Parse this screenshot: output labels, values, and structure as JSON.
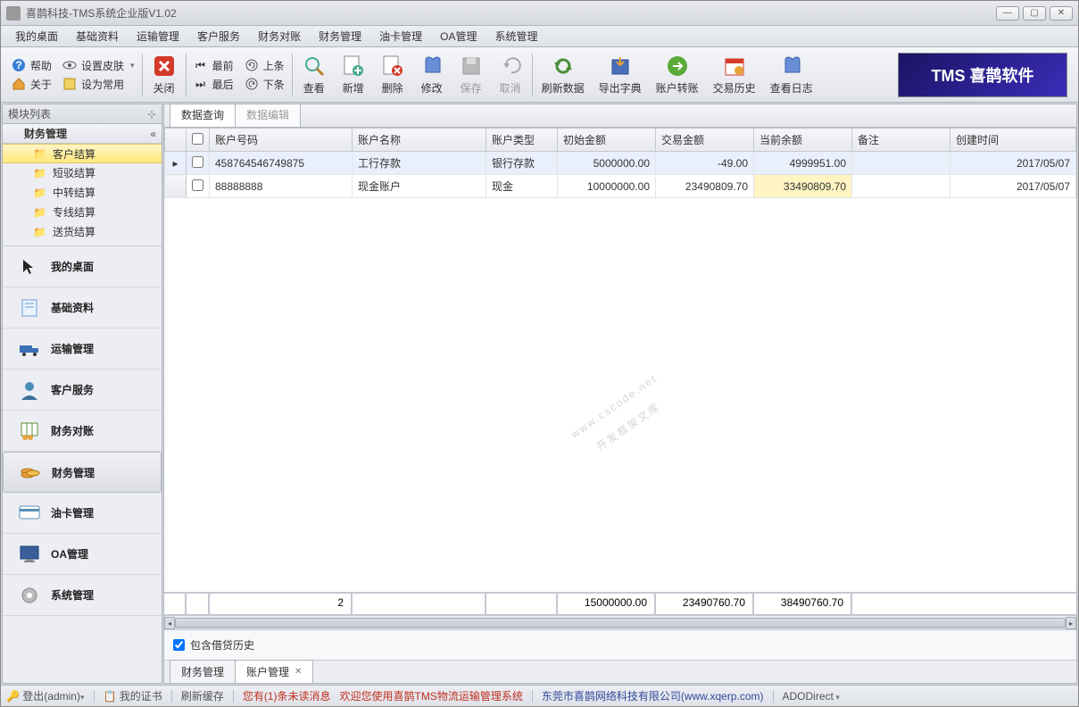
{
  "window": {
    "title": "喜鹊科技-TMS系统企业版V1.02"
  },
  "menubar": [
    "我的桌面",
    "基础资料",
    "运输管理",
    "客户服务",
    "财务对账",
    "财务管理",
    "油卡管理",
    "OA管理",
    "系统管理"
  ],
  "toolbar_left": {
    "help": "帮助",
    "skin": "设置皮肤",
    "about": "关于",
    "fav": "设为常用"
  },
  "toolbar_close": "关闭",
  "toolbar_nav": {
    "first": "最前",
    "last": "最后",
    "prev": "上条",
    "next": "下条"
  },
  "toolbar_big": [
    "查看",
    "新增",
    "删除",
    "修改",
    "保存",
    "取消",
    "刷新数据",
    "导出字典",
    "账户转账",
    "交易历史",
    "查看日志"
  ],
  "brand": "TMS 喜鹊软件",
  "sidebar": {
    "header": "模块列表",
    "tree_header": "财务管理",
    "tree_items": [
      "客户结算",
      "短驳结算",
      "中转结算",
      "专线结算",
      "送货结算"
    ],
    "nav": [
      "我的桌面",
      "基础资料",
      "运输管理",
      "客户服务",
      "财务对账",
      "财务管理",
      "油卡管理",
      "OA管理",
      "系统管理"
    ]
  },
  "inner_tabs": [
    "数据查询",
    "数据编辑"
  ],
  "table": {
    "headers": [
      "账户号码",
      "账户名称",
      "账户类型",
      "初始金额",
      "交易金额",
      "当前余额",
      "备注",
      "创建时间"
    ],
    "rows": [
      {
        "no": "458764546749875",
        "name": "工行存款",
        "type": "银行存款",
        "init": "5000000.00",
        "trade": "-49.00",
        "bal": "4999951.00",
        "note": "",
        "date": "2017/05/07"
      },
      {
        "no": "88888888",
        "name": "现金账户",
        "type": "现金",
        "init": "10000000.00",
        "trade": "23490809.70",
        "bal": "33490809.70",
        "note": "",
        "date": "2017/05/07"
      }
    ],
    "sum": {
      "count": "2",
      "init": "15000000.00",
      "trade": "23490760.70",
      "bal": "38490760.70"
    }
  },
  "watermark1": "www.cscode.net",
  "watermark2": "开发框架文库",
  "foot_check": "包含借贷历史",
  "doc_tabs": [
    "财务管理",
    "账户管理"
  ],
  "status": {
    "login": "登出(admin)",
    "cert": "我的证书",
    "refresh": "刷新缓存",
    "msg": "您有(1)条未读消息",
    "welcome": "欢迎您使用喜鹊TMS物流运输管理系统",
    "company": "东莞市喜鹊网络科技有限公司(www.xqerp.com)",
    "mode": "ADODirect"
  }
}
